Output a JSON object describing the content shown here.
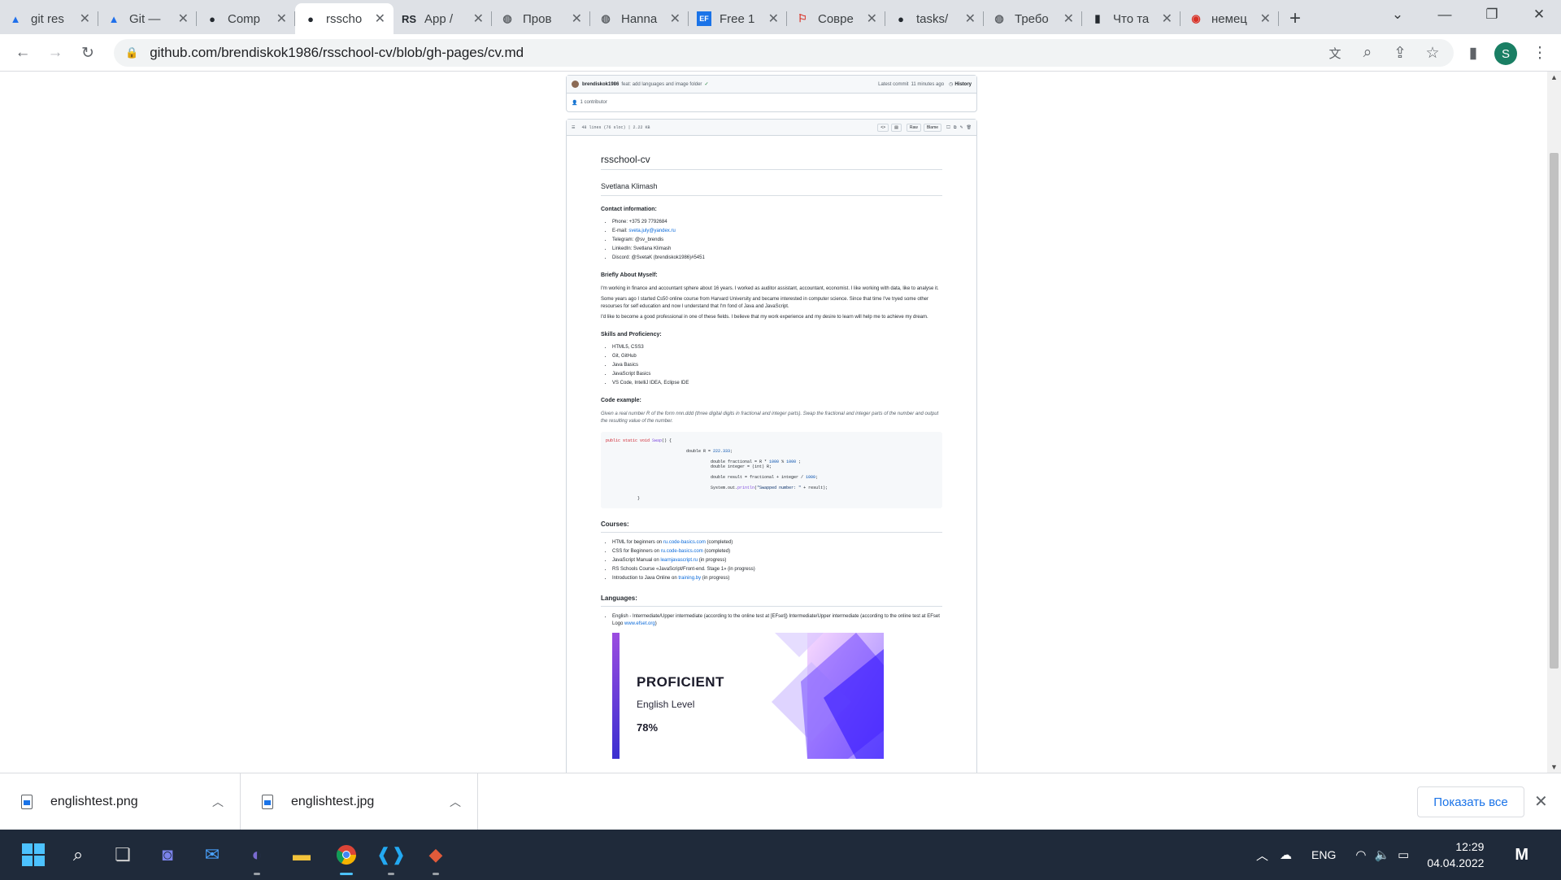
{
  "browser": {
    "tabs": [
      {
        "label": "git res",
        "icon": "azure-devops-icon",
        "color": "#1f6feb"
      },
      {
        "label": "Git —",
        "icon": "azure-devops-icon",
        "color": "#1f6feb"
      },
      {
        "label": "Comp",
        "icon": "github-icon",
        "color": "#24292f"
      },
      {
        "label": "rsscho",
        "icon": "github-icon",
        "color": "#24292f",
        "active": true
      },
      {
        "label": "App /",
        "icon": "rs-school-icon",
        "color": "#24292f"
      },
      {
        "label": "Пров",
        "icon": "globe-icon",
        "color": "#5f6368"
      },
      {
        "label": "Hanna",
        "icon": "globe-icon",
        "color": "#5f6368"
      },
      {
        "label": "Free 1",
        "icon": "ef-icon",
        "color": "#1a73e8"
      },
      {
        "label": "Совре",
        "icon": "figure-icon",
        "color": "#d93025"
      },
      {
        "label": "tasks/",
        "icon": "github-icon",
        "color": "#24292f"
      },
      {
        "label": "Требо",
        "icon": "globe-icon",
        "color": "#5f6368"
      },
      {
        "label": "Что та",
        "icon": "bookmark-icon",
        "color": "#24292f"
      },
      {
        "label": "немец",
        "icon": "translate-icon",
        "color": "#d93025"
      }
    ],
    "url": "github.com/brendiskok1986/rsschool-cv/blob/gh-pages/cv.md",
    "profile_initial": "S"
  },
  "commit": {
    "author": "brendiskok1986",
    "message": "feat: add languages and image folder",
    "latest": "Latest commit",
    "time": "11 minutes ago",
    "history": "History",
    "contributors": "1 contributor"
  },
  "file": {
    "info": "48 lines (76 sloc)  |  2.22 KB",
    "raw": "Raw",
    "blame": "Blame"
  },
  "cv": {
    "title": "rsschool-cv",
    "name": "Svetlana Klimash",
    "contact_heading": "Contact information:",
    "contacts": [
      {
        "label": "Phone: +375 29 7792684",
        "link": ""
      },
      {
        "label": "E-mail: ",
        "link": "sveta.july@yandex.ru"
      },
      {
        "label": "Telegram: @sv_brendis",
        "link": ""
      },
      {
        "label": "LinkedIn: Svetlana Klimash",
        "link": ""
      },
      {
        "label": "Discord: @SvetaK (brendiskok1986)#5451",
        "link": ""
      }
    ],
    "about_heading": "Briefly About Myself:",
    "about": [
      "I'm working in finance and accountant sphere about 16 years. I worked as auditor assistant, accountant, economist. I like working with data, like to analyse it.",
      "Some years ago I started Cs50 online course from Harvard University and became interested in computer science. Since that time I've tryed some other resourses for self education and now I understand that I'm fond of Java and JavaScript.",
      "I'd like to become a good professional in one of these fields. I believe that my work experience and my desire to learn will help me to achieve my dream."
    ],
    "skills_heading": "Skills and Proficiency:",
    "skills": [
      "HTML5, CSS3",
      "Git, GitHub",
      "Java Basics",
      "JavaScript Basics",
      "VS Code, IntelliJ IDEA, Eclipse IDE"
    ],
    "code_heading": "Code example:",
    "code_desc": "Given a real number R of the form nnn.ddd (three digital digits in fractional and integer parts). Swap the fractional and integer parts of the number and output the resulting value of the number.",
    "code_lines": [
      "public static void Swap() {",
      "double R = 222.333;",
      "double fractional = R * 1000 % 1000 ;",
      "double integer = (int) R;",
      "double result = fractional + integer / 1000;",
      "System.out.println(\"Swapped number: \" + result);",
      "}"
    ],
    "courses_heading": "Courses:",
    "courses": [
      {
        "pre": "HTML for beginners on ",
        "link": "ru.code-basics.com",
        "post": " (completed)"
      },
      {
        "pre": "CSS for Beginners on ",
        "link": "ru.code-basics.com",
        "post": " (completed)"
      },
      {
        "pre": "JavaScript Manual on ",
        "link": "learnjavascript.ru",
        "post": " (in progress)"
      },
      {
        "pre": "RS Schools Course «JavaScript/Front-end. Stage 1» (in progress)",
        "link": "",
        "post": ""
      },
      {
        "pre": "Introduction to Java Online on ",
        "link": "training.by",
        "post": " (in progress)"
      }
    ],
    "languages_heading": "Languages:",
    "language_item": "English - Intermediate/Upper intermediate (according to the online test at [EFset]) Intermediate/Upper intermediate (according to the online test at EFset Logo ",
    "language_link": "www.efset.org",
    "language_close": ")",
    "badge": {
      "level": "PROFICIENT",
      "subtitle": "English Level",
      "score": "78%"
    }
  },
  "downloads": {
    "items": [
      "englishtest.png",
      "englishtest.jpg"
    ],
    "show_all": "Показать все"
  },
  "taskbar": {
    "lang": "ENG",
    "time": "12:29",
    "date": "04.04.2022"
  }
}
